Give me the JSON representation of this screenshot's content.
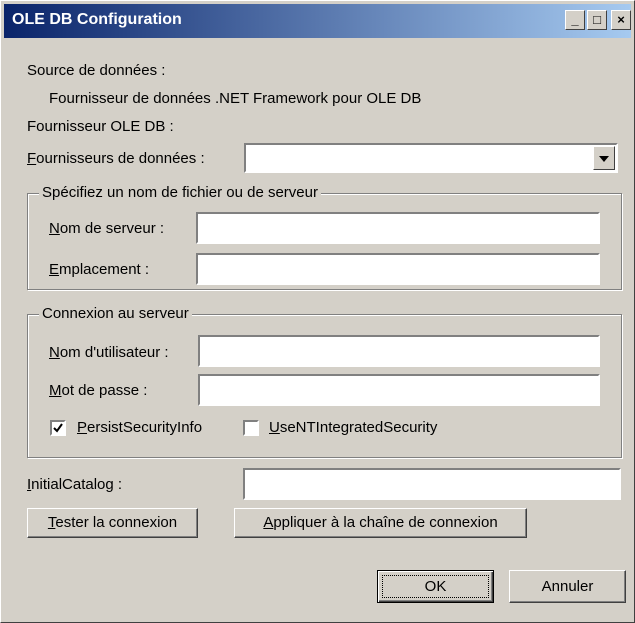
{
  "window": {
    "title": "OLE DB Configuration",
    "min_glyph": "_",
    "max_glyph": "□",
    "close_glyph": "×"
  },
  "source": {
    "label": "Source de données :",
    "value": "Fournisseur de données .NET Framework pour OLE DB",
    "provider_label": "Fournisseur OLE DB :"
  },
  "providers": {
    "label_key": "F",
    "label_rest": "ournisseurs de données :",
    "selected": ""
  },
  "server_group": {
    "legend": "Spécifiez un nom de fichier ou de serveur",
    "server_key": "N",
    "server_rest": "om de serveur :",
    "server_value": "",
    "location_key": "E",
    "location_rest": "mplacement :",
    "location_value": ""
  },
  "connection_group": {
    "legend": "Connexion au serveur",
    "user_key": "N",
    "user_rest": "om d'utilisateur :",
    "user_value": "",
    "password_key": "M",
    "password_rest": "ot de passe :",
    "password_value": "",
    "persist_key": "P",
    "persist_rest": "ersistSecurityInfo",
    "persist_checked": true,
    "nt_key": "U",
    "nt_rest": "seNTIntegratedSecurity",
    "nt_checked": false
  },
  "catalog": {
    "label_key": "I",
    "label_rest": "nitialCatalog :",
    "value": ""
  },
  "buttons": {
    "test_key": "T",
    "test_rest": "ester la connexion",
    "apply_key": "A",
    "apply_rest": "ppliquer à la chaîne de connexion",
    "ok": "OK",
    "cancel": "Annuler"
  }
}
